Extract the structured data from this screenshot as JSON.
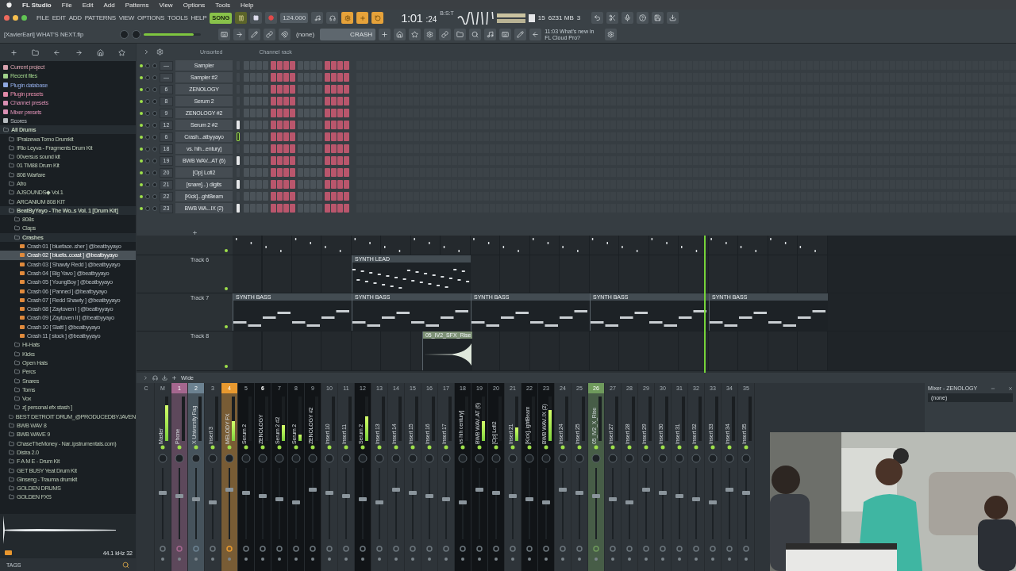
{
  "menu_bar": {
    "app": "FL Studio",
    "items": [
      "File",
      "Edit",
      "Add",
      "Patterns",
      "View",
      "Options",
      "Tools",
      "Help"
    ]
  },
  "toolbar": {
    "menus": [
      "FILE",
      "EDIT",
      "ADD",
      "PATTERNS",
      "VIEW",
      "OPTIONS",
      "TOOLS",
      "HELP"
    ],
    "song_mode": {
      "label": "SONG",
      "on": true
    },
    "playing": true,
    "tempo": "124.000",
    "time": "1:01",
    "time_ticks": ":24",
    "time_format": "B:S:T",
    "cpu": "15",
    "memory": "6231 MB",
    "polyphony": "3",
    "project": "[XavierEarl] WHAT'S NEXT.flp",
    "master_volume": {
      "level": 0.88
    },
    "snap": "(none)",
    "pattern": "CRASH",
    "hint": "11:03 What's new in FL Cloud Pro?"
  },
  "browser": {
    "shortcuts": [
      {
        "label": "Current project",
        "color": "#d7a1ad"
      },
      {
        "label": "Recent files",
        "color": "#9fd08a"
      },
      {
        "label": "Plugin database",
        "color": "#8fa8e0"
      },
      {
        "label": "Plugin presets",
        "color": "#e08aa8"
      },
      {
        "label": "Channel presets",
        "color": "#d98fb3"
      },
      {
        "label": "Mixer presets",
        "color": "#d98fb3"
      },
      {
        "label": "Scores",
        "color": "#b7bcc0"
      }
    ],
    "tree": [
      {
        "label": "All Drums",
        "kind": "folder",
        "expanded": true,
        "children": [
          {
            "label": "!Praizewa Tomo Drumkit",
            "kind": "folder",
            "expanded": false
          },
          {
            "label": "!Rio Leyva - Fragments Drum Kit",
            "kind": "folder",
            "expanded": false
          },
          {
            "label": "00versus sound kit",
            "kind": "folder",
            "expanded": false
          },
          {
            "label": "01 TM88 Drum Kit",
            "kind": "folder",
            "expanded": false
          },
          {
            "label": "808 Warfare",
            "kind": "folder",
            "expanded": false
          },
          {
            "label": "Afro",
            "kind": "folder",
            "expanded": false
          },
          {
            "label": "AJSOUNDS◆ Vol.1",
            "kind": "folder",
            "expanded": false
          },
          {
            "label": "ARCANIUM 808 KIT",
            "kind": "folder",
            "expanded": false
          },
          {
            "label": "BeatByYayo - The Wo..s Vol. 1 [Drum Kit]",
            "kind": "folder",
            "expanded": true,
            "children": [
              {
                "label": "808s",
                "kind": "folder",
                "expanded": false
              },
              {
                "label": "Claps",
                "kind": "folder",
                "expanded": false
              },
              {
                "label": "Crashes",
                "kind": "folder",
                "expanded": true,
                "children": [
                  {
                    "label": "Crash 01 [ blueface..sher ] @beatbyyayo",
                    "kind": "file",
                    "selected": false
                  },
                  {
                    "label": "Crash 02 [ bluefa..coast ] @beatbyyayo",
                    "kind": "file",
                    "selected": true
                  },
                  {
                    "label": "Crash 03 [ Shawty Redd ] @beatbyyayo",
                    "kind": "file",
                    "selected": false
                  },
                  {
                    "label": "Crash 04 [ Big Yavo ] @beatbyyayo",
                    "kind": "file",
                    "selected": false
                  },
                  {
                    "label": "Crash 05 [ YoungBoy ] @beatbyyayo",
                    "kind": "file",
                    "selected": false
                  },
                  {
                    "label": "Crash 06 [ Panned ] @beatbyyayo",
                    "kind": "file",
                    "selected": false
                  },
                  {
                    "label": "Crash 07 [ Redd Shawty ] @beatbyyayo",
                    "kind": "file",
                    "selected": false
                  },
                  {
                    "label": "Crash 08 [ Zaytoven I ] @beatbyyayo",
                    "kind": "file",
                    "selected": false
                  },
                  {
                    "label": "Crash 09 [ Zaytoven II ] @beatbyyayo",
                    "kind": "file",
                    "selected": false
                  },
                  {
                    "label": "Crash 10 [ Slatt! ] @beatbyyayo",
                    "kind": "file",
                    "selected": false
                  },
                  {
                    "label": "Crash 11 [ stock ] @beatbyyayo",
                    "kind": "file",
                    "selected": false
                  }
                ]
              },
              {
                "label": "Hi-Hats",
                "kind": "folder",
                "expanded": false
              },
              {
                "label": "Kicks",
                "kind": "folder",
                "expanded": false
              },
              {
                "label": "Open Hats",
                "kind": "folder",
                "expanded": false
              },
              {
                "label": "Percs",
                "kind": "folder",
                "expanded": false
              },
              {
                "label": "Snares",
                "kind": "folder",
                "expanded": false
              },
              {
                "label": "Toms",
                "kind": "folder",
                "expanded": false
              },
              {
                "label": "Vox",
                "kind": "folder",
                "expanded": false
              },
              {
                "label": "z[ personal efx stash ]",
                "kind": "folder",
                "expanded": false
              }
            ]
          },
          {
            "label": "BEST DETROIT DRUM_@PRODUCEDBYJAVEN",
            "kind": "folder",
            "expanded": false
          },
          {
            "label": "BWB WAV 8",
            "kind": "folder",
            "expanded": false
          },
          {
            "label": "BWB WAVE 9",
            "kind": "folder",
            "expanded": false
          },
          {
            "label": "ChaseTheMoney - Nar..ipstrumentals.com)",
            "kind": "folder",
            "expanded": false
          },
          {
            "label": "Distra 2.0",
            "kind": "folder",
            "expanded": false
          },
          {
            "label": "F A M E - Drum Kit",
            "kind": "folder",
            "expanded": false
          },
          {
            "label": "GET BUSY Yeat Drum Kit",
            "kind": "folder",
            "expanded": false
          },
          {
            "label": "Ginseng - Trauma drumkit",
            "kind": "folder",
            "expanded": false
          },
          {
            "label": "GOLDEN DRUMS",
            "kind": "folder",
            "expanded": false
          },
          {
            "label": "GOLDEN FXS",
            "kind": "folder",
            "expanded": false
          }
        ]
      }
    ],
    "preview_format": "44.1 kHz 32",
    "tags_label": "TAGS"
  },
  "channel_rack": {
    "filter": "Unsorted",
    "title": "Channel rack",
    "channels": [
      {
        "mixer": "—",
        "name": "Sampler",
        "selected": false,
        "active": false,
        "steps": [
          false,
          false,
          false,
          false,
          true,
          true,
          true,
          true,
          false,
          false,
          false,
          false,
          true,
          true,
          true,
          true
        ]
      },
      {
        "mixer": "—",
        "name": "Sampler #2",
        "selected": false,
        "active": false,
        "steps": [
          false,
          false,
          false,
          false,
          true,
          true,
          true,
          true,
          false,
          false,
          false,
          false,
          true,
          true,
          true,
          true
        ]
      },
      {
        "mixer": "6",
        "name": "ZENOLOGY",
        "selected": false,
        "active": false,
        "steps": [
          false,
          false,
          false,
          false,
          true,
          true,
          true,
          true,
          false,
          false,
          false,
          false,
          true,
          true,
          true,
          true
        ]
      },
      {
        "mixer": "8",
        "name": "Serum 2",
        "selected": false,
        "active": false,
        "steps": [
          false,
          false,
          false,
          false,
          true,
          true,
          true,
          true,
          false,
          false,
          false,
          false,
          true,
          true,
          true,
          true
        ]
      },
      {
        "mixer": "9",
        "name": "ZENOLOGY #2",
        "selected": false,
        "active": false,
        "steps": [
          false,
          false,
          false,
          false,
          true,
          true,
          true,
          true,
          false,
          false,
          false,
          false,
          true,
          true,
          true,
          true
        ]
      },
      {
        "mixer": "12",
        "name": "Serum 2 #2",
        "selected": false,
        "active": true,
        "steps": [
          false,
          false,
          false,
          false,
          true,
          true,
          true,
          true,
          false,
          false,
          false,
          false,
          true,
          true,
          true,
          true
        ]
      },
      {
        "mixer": "6",
        "name": "Crash...atbyyayo",
        "selected": true,
        "active": false,
        "steps": [
          false,
          false,
          false,
          false,
          true,
          true,
          true,
          true,
          false,
          false,
          false,
          false,
          true,
          true,
          true,
          true
        ]
      },
      {
        "mixer": "18",
        "name": "vs. hih...entury]",
        "selected": false,
        "active": false,
        "steps": [
          false,
          false,
          false,
          false,
          true,
          true,
          true,
          true,
          false,
          false,
          false,
          false,
          true,
          true,
          true,
          true
        ]
      },
      {
        "mixer": "19",
        "name": "BWB WAV...AT (6)",
        "selected": false,
        "active": true,
        "steps": [
          false,
          false,
          false,
          false,
          true,
          true,
          true,
          true,
          false,
          false,
          false,
          false,
          true,
          true,
          true,
          true
        ]
      },
      {
        "mixer": "20",
        "name": "[Op] Lofi2",
        "selected": false,
        "active": false,
        "steps": [
          false,
          false,
          false,
          false,
          true,
          true,
          true,
          true,
          false,
          false,
          false,
          false,
          true,
          true,
          true,
          true
        ]
      },
      {
        "mixer": "21",
        "name": "[snare]...) digits",
        "selected": false,
        "active": true,
        "steps": [
          false,
          false,
          false,
          false,
          true,
          true,
          true,
          true,
          false,
          false,
          false,
          false,
          true,
          true,
          true,
          true
        ]
      },
      {
        "mixer": "22",
        "name": "[Kick]...ghtBeam",
        "selected": false,
        "active": false,
        "steps": [
          false,
          false,
          false,
          false,
          true,
          true,
          true,
          true,
          false,
          false,
          false,
          false,
          true,
          true,
          true,
          true
        ]
      },
      {
        "mixer": "23",
        "name": "BWB WA...IX (2)",
        "selected": false,
        "active": true,
        "steps": [
          false,
          false,
          false,
          false,
          true,
          true,
          true,
          true,
          false,
          false,
          false,
          false,
          true,
          true,
          true,
          true
        ]
      }
    ]
  },
  "playlist": {
    "tracks": [
      {
        "kind": "drums"
      },
      {
        "name": "Track 6",
        "kind": "lead",
        "clips": [
          "SYNTH LEAD"
        ]
      },
      {
        "name": "Track 7",
        "kind": "bass",
        "clips": [
          "SYNTH BASS",
          "SYNTH BASS",
          "SYNTH BASS",
          "SYNTH BASS",
          "SYNTH BASS"
        ]
      },
      {
        "name": "Track 8",
        "kind": "audio",
        "clips": [
          "05_IV2_SFX_Rise"
        ]
      }
    ]
  },
  "mixer": {
    "mode": "Wide",
    "strips": [
      {
        "number": "C",
        "kind": "current",
        "selected": false,
        "highlighted": false
      },
      {
        "number": "M",
        "name": "Master",
        "kind": "master",
        "level": 0.8,
        "selected": false,
        "highlighted": false
      },
      {
        "number": "1",
        "name": "Phone",
        "kind": "insert",
        "color": "#a5678f",
        "selected": false,
        "highlighted": false
      },
      {
        "number": "2",
        "name": "X University Fag",
        "kind": "insert",
        "color": "#6c8291",
        "selected": false,
        "highlighted": false
      },
      {
        "number": "3",
        "name": "Insert 3",
        "kind": "insert",
        "selected": false,
        "highlighted": false
      },
      {
        "number": "4",
        "name": "MELODY FX",
        "kind": "insert",
        "color": "#e8992f",
        "level": 0.45,
        "selected": false,
        "highlighted": false
      },
      {
        "number": "5",
        "name": "Serum 2",
        "kind": "insert",
        "selected": false,
        "highlighted": true
      },
      {
        "number": "6",
        "name": "ZENOLOGY",
        "kind": "insert",
        "selected": true,
        "highlighted": true
      },
      {
        "number": "7",
        "name": "Serum 2 #2",
        "kind": "insert",
        "level": 0.35,
        "selected": false,
        "highlighted": true
      },
      {
        "number": "8",
        "name": "Serum 2",
        "kind": "insert",
        "level": 0.15,
        "selected": false,
        "highlighted": true
      },
      {
        "number": "9",
        "name": "ZENOLOGY #2",
        "kind": "insert",
        "selected": false,
        "highlighted": true
      },
      {
        "number": "10",
        "name": "Insert 10",
        "kind": "insert",
        "selected": false,
        "highlighted": false
      },
      {
        "number": "11",
        "name": "Insert 11",
        "kind": "insert",
        "selected": false,
        "highlighted": false
      },
      {
        "number": "12",
        "name": "Serum 2",
        "kind": "insert",
        "level": 0.55,
        "selected": false,
        "highlighted": true
      },
      {
        "number": "13",
        "name": "Insert 13",
        "kind": "insert",
        "selected": false,
        "highlighted": false
      },
      {
        "number": "14",
        "name": "Insert 14",
        "kind": "insert",
        "selected": false,
        "highlighted": false
      },
      {
        "number": "15",
        "name": "Insert 15",
        "kind": "insert",
        "selected": false,
        "highlighted": false
      },
      {
        "number": "16",
        "name": "Insert 16",
        "kind": "insert",
        "selected": false,
        "highlighted": false
      },
      {
        "number": "17",
        "name": "Insert 17",
        "kind": "insert",
        "selected": false,
        "highlighted": false
      },
      {
        "number": "18",
        "name": "vs hih century]",
        "kind": "insert",
        "selected": false,
        "highlighted": true
      },
      {
        "number": "19",
        "name": "BWB WAV..AT (6)",
        "kind": "insert",
        "level": 0.45,
        "selected": false,
        "highlighted": true
      },
      {
        "number": "20",
        "name": "[Op] Lofi2",
        "kind": "insert",
        "selected": false,
        "highlighted": true
      },
      {
        "number": "21",
        "name": "Insert 21",
        "kind": "insert",
        "level": 0.3,
        "selected": false,
        "highlighted": false
      },
      {
        "number": "22",
        "name": "[Kick]..ightBeam",
        "kind": "insert",
        "selected": false,
        "highlighted": true
      },
      {
        "number": "23",
        "name": "BWB WAV..IX (2)",
        "kind": "insert",
        "level": 0.7,
        "selected": false,
        "highlighted": true
      },
      {
        "number": "24",
        "name": "Insert 24",
        "kind": "insert",
        "selected": false,
        "highlighted": false
      },
      {
        "number": "25",
        "name": "Insert 25",
        "kind": "insert",
        "selected": false,
        "highlighted": false
      },
      {
        "number": "26",
        "name": "05_IV2_X_Rise",
        "kind": "insert",
        "color": "#6f9a5c",
        "selected": false,
        "highlighted": false
      },
      {
        "number": "27",
        "name": "Insert 27",
        "kind": "insert",
        "selected": false,
        "highlighted": false
      },
      {
        "number": "28",
        "name": "Insert 28",
        "kind": "insert",
        "selected": false,
        "highlighted": false
      },
      {
        "number": "29",
        "name": "Insert 29",
        "kind": "insert",
        "selected": false,
        "highlighted": false
      },
      {
        "number": "30",
        "name": "Insert 30",
        "kind": "insert",
        "selected": false,
        "highlighted": false
      },
      {
        "number": "31",
        "name": "Insert 31",
        "kind": "insert",
        "selected": false,
        "highlighted": false
      },
      {
        "number": "32",
        "name": "Insert 32",
        "kind": "insert",
        "selected": false,
        "highlighted": false
      },
      {
        "number": "33",
        "name": "Insert 33",
        "kind": "insert",
        "selected": false,
        "highlighted": false
      },
      {
        "number": "34",
        "name": "Insert 34",
        "kind": "insert",
        "selected": false,
        "highlighted": false
      },
      {
        "number": "35",
        "name": "Insert 35",
        "kind": "insert",
        "selected": false,
        "highlighted": false
      }
    ],
    "effects_panel": {
      "title": "Mixer - ZENOLOGY",
      "input": "(none)"
    }
  }
}
